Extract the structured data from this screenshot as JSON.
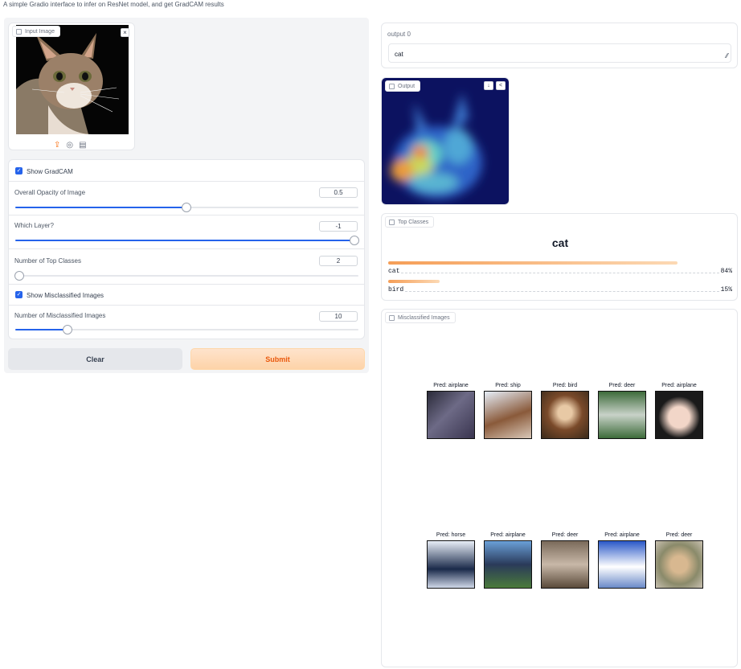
{
  "description": "A simple Gradio interface to infer on ResNet model, and get GradCAM results",
  "input": {
    "label": "Input Image",
    "close_icon": "close-icon",
    "upload_icon": "upload-icon",
    "webcam_icon": "webcam-icon",
    "clipboard_icon": "clipboard-icon"
  },
  "controls": {
    "show_gradcam": {
      "label": "Show GradCAM",
      "checked": true
    },
    "opacity": {
      "label": "Overall Opacity of Image",
      "value": "0.5"
    },
    "layer": {
      "label": "Which Layer?",
      "value": "-1"
    },
    "top_classes": {
      "label": "Number of Top Classes",
      "value": "2"
    },
    "show_misclassified": {
      "label": "Show Misclassified Images",
      "checked": true
    },
    "num_misclassified": {
      "label": "Number of Misclassified Images",
      "value": "10"
    }
  },
  "buttons": {
    "clear": "Clear",
    "submit": "Submit"
  },
  "output0": {
    "label": "output 0",
    "value": "cat"
  },
  "gradcam": {
    "label": "Output"
  },
  "top": {
    "label": "Top Classes",
    "predicted": "cat",
    "classes": [
      {
        "name": "cat",
        "pct": "84%",
        "fraction": 0.84
      },
      {
        "name": "bird",
        "pct": "15%",
        "fraction": 0.15
      }
    ]
  },
  "misclassified": {
    "label": "Misclassified Images",
    "items": [
      {
        "caption": "Pred: airplane"
      },
      {
        "caption": "Pred: ship"
      },
      {
        "caption": "Pred: bird"
      },
      {
        "caption": "Pred: deer"
      },
      {
        "caption": "Pred: airplane"
      },
      {
        "caption": "Pred: horse"
      },
      {
        "caption": "Pred: airplane"
      },
      {
        "caption": "Pred: deer"
      },
      {
        "caption": "Pred: airplane"
      },
      {
        "caption": "Pred: deer"
      }
    ]
  }
}
